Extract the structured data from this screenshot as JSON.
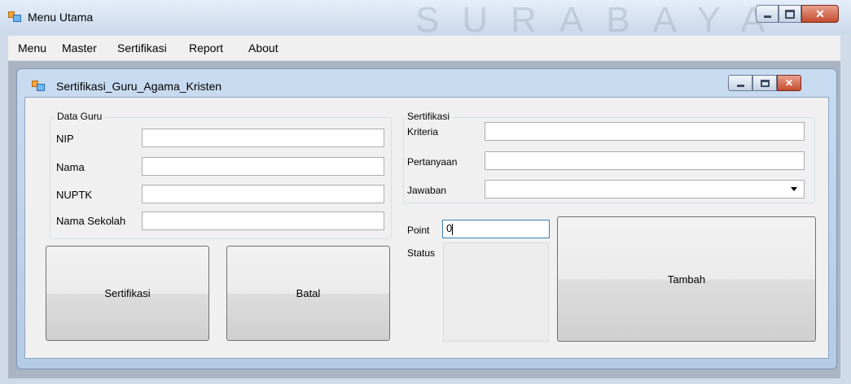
{
  "window": {
    "title": "Menu Utama",
    "watermark": "SURABAYA"
  },
  "menubar": {
    "items": [
      "Menu",
      "Master",
      "Sertifikasi",
      "Report",
      "About"
    ]
  },
  "child_window": {
    "title": "Sertifikasi_Guru_Agama_Kristen"
  },
  "data_guru": {
    "legend": "Data Guru",
    "nip_label": "NIP",
    "nip_value": "",
    "nama_label": "Nama",
    "nama_value": "",
    "nuptk_label": "NUPTK",
    "nuptk_value": "",
    "sekolah_label": "Nama Sekolah",
    "sekolah_value": ""
  },
  "sertifikasi": {
    "legend": "Sertifikasi",
    "kriteria_label": "Kriteria",
    "kriteria_value": "",
    "pertanyaan_label": "Pertanyaan",
    "pertanyaan_value": "",
    "jawaban_label": "Jawaban",
    "jawaban_value": ""
  },
  "point": {
    "label": "Point",
    "value": "0"
  },
  "status": {
    "label": "Status"
  },
  "buttons": {
    "sertifikasi": "Sertifikasi",
    "batal": "Batal",
    "tambah": "Tambah"
  },
  "icons": {
    "app": "app-window-icon",
    "minimize": "minimize-icon",
    "maximize": "maximize-icon",
    "close": "close-icon",
    "dropdown": "chevron-down-icon"
  }
}
